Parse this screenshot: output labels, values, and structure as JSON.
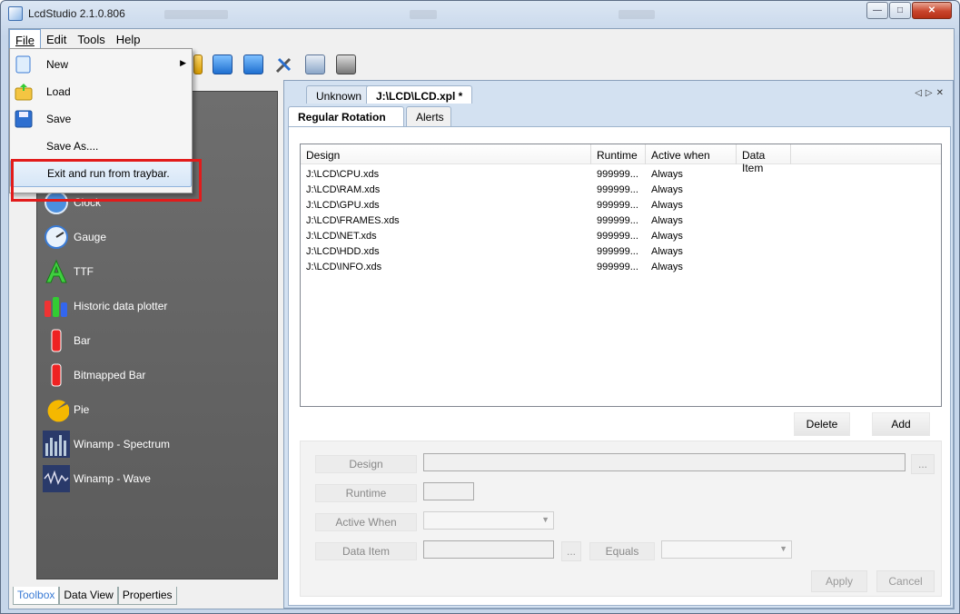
{
  "window": {
    "title": "LcdStudio 2.1.0.806"
  },
  "menubar": {
    "items": [
      {
        "label": "File"
      },
      {
        "label": "Edit"
      },
      {
        "label": "Tools"
      },
      {
        "label": "Help"
      }
    ]
  },
  "file_menu": {
    "items": [
      {
        "label": "New",
        "icon": "new-document-icon",
        "submenu": true
      },
      {
        "label": "Load",
        "icon": "open-folder-icon"
      },
      {
        "label": "Save",
        "icon": "save-disk-icon"
      },
      {
        "label": "Save As...."
      },
      {
        "label": "Exit and run from traybar.",
        "highlighted": true
      }
    ]
  },
  "toolbox": {
    "items": [
      {
        "label": "Clock",
        "icon": "clock-icon"
      },
      {
        "label": "Gauge",
        "icon": "gauge-icon"
      },
      {
        "label": "TTF",
        "icon": "ttf-font-icon"
      },
      {
        "label": "Historic data plotter",
        "icon": "plotter-icon"
      },
      {
        "label": "Bar",
        "icon": "bar-icon"
      },
      {
        "label": "Bitmapped Bar",
        "icon": "bitmapped-bar-icon"
      },
      {
        "label": "Pie",
        "icon": "pie-icon"
      },
      {
        "label": "Winamp - Spectrum",
        "icon": "spectrum-icon"
      },
      {
        "label": "Winamp - Wave",
        "icon": "wave-icon"
      }
    ]
  },
  "left_tabs": {
    "toolbox": "Toolbox",
    "data_view": "Data View",
    "properties": "Properties"
  },
  "doc_tabs": {
    "tab1": "Unknown",
    "tab2": "J:\\LCD\\LCD.xpl *"
  },
  "inner_tabs": {
    "regular_rotation": "Regular Rotation",
    "alerts": "Alerts"
  },
  "table": {
    "headers": [
      "Design",
      "Runtime",
      "Active when",
      "Data Item"
    ],
    "rows": [
      [
        "J:\\LCD\\CPU.xds",
        "999999...",
        "Always",
        ""
      ],
      [
        "J:\\LCD\\RAM.xds",
        "999999...",
        "Always",
        ""
      ],
      [
        "J:\\LCD\\GPU.xds",
        "999999...",
        "Always",
        ""
      ],
      [
        "J:\\LCD\\FRAMES.xds",
        "999999...",
        "Always",
        ""
      ],
      [
        "J:\\LCD\\NET.xds",
        "999999...",
        "Always",
        ""
      ],
      [
        "J:\\LCD\\HDD.xds",
        "999999...",
        "Always",
        ""
      ],
      [
        "J:\\LCD\\INFO.xds",
        "999999...",
        "Always",
        ""
      ]
    ]
  },
  "buttons": {
    "delete": "Delete",
    "add": "Add",
    "apply": "Apply",
    "cancel": "Cancel",
    "browse": "...",
    "browse2": "..."
  },
  "form": {
    "design": "Design",
    "runtime": "Runtime",
    "active_when": "Active When",
    "data_item": "Data Item",
    "equals": "Equals"
  }
}
